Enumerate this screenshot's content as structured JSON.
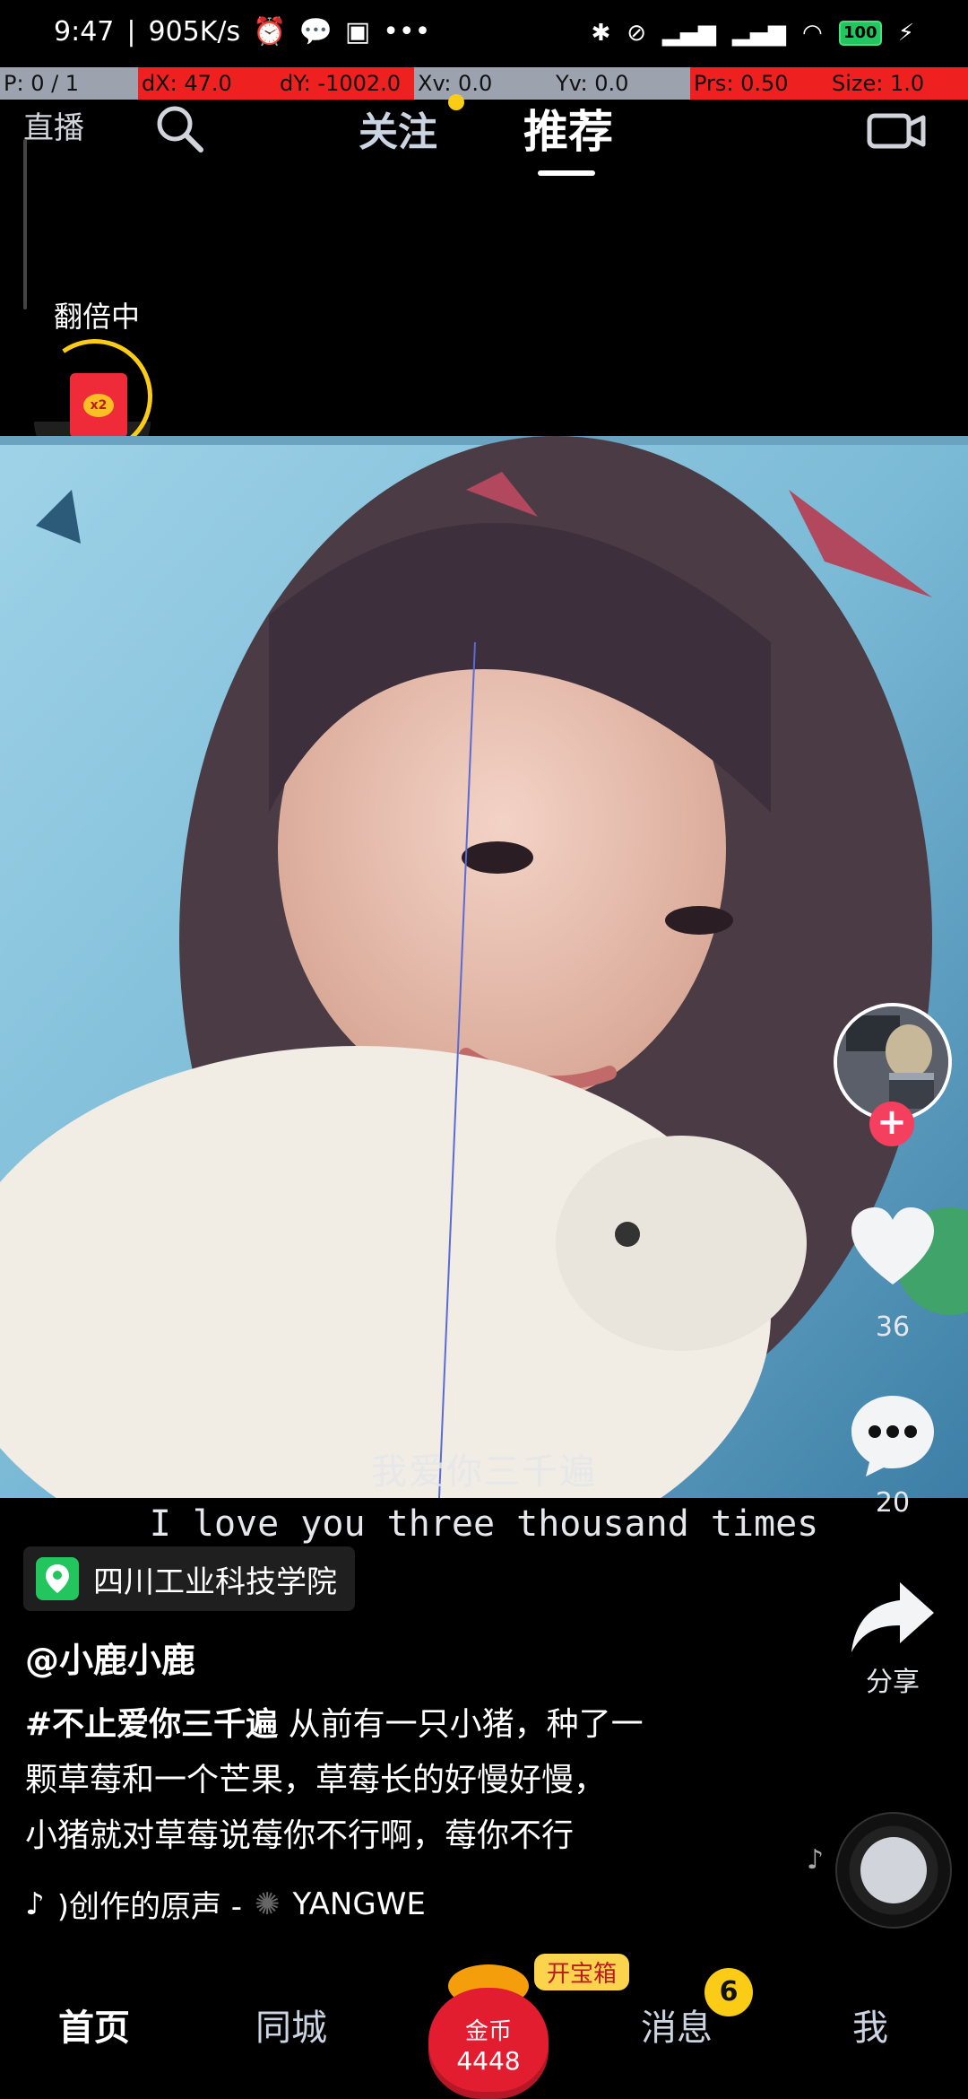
{
  "status_bar": {
    "time": "9:47",
    "net_speed": "905K/s",
    "battery": "100"
  },
  "debug_overlay": {
    "pointer": "P: 0 / 1",
    "dx": "dX: 47.0",
    "dy": "dY: -1002.0",
    "xv": "Xv: 0.0",
    "yv": "Yv: 0.0",
    "prs": "Prs: 0.50",
    "size": "Size: 1.0"
  },
  "top_nav": {
    "live": "直播",
    "tab_follow": "关注",
    "tab_recommend": "推荐"
  },
  "red_packet": {
    "label": "翻倍中",
    "multiplier": "x2"
  },
  "video": {
    "subtitle_cn": "我爱你三千遍",
    "subtitle_en": "I love you three thousand times"
  },
  "rail": {
    "likes": "36",
    "comments": "20",
    "share": "分享"
  },
  "post": {
    "location": "四川工业科技学院",
    "author": "@小鹿小鹿",
    "hashtag": "#不止爱你三千遍",
    "caption_line1": "从前有一只小猪，种了一",
    "caption_line2": "颗草莓和一个芒果，草莓长的好慢好慢，",
    "caption_line3": "小猪就对草莓说莓你不行啊，莓你不行",
    "music": ")创作的原声 -",
    "music_author": "YANGWE"
  },
  "bottom_nav": {
    "home": "首页",
    "nearby": "同城",
    "coin_label": "金币",
    "coin_count": "4448",
    "treasure": "开宝箱",
    "messages": "消息",
    "messages_badge": "6",
    "me": "我"
  },
  "colors": {
    "accent_red": "#f43f5e",
    "badge_yellow": "#facc15"
  }
}
